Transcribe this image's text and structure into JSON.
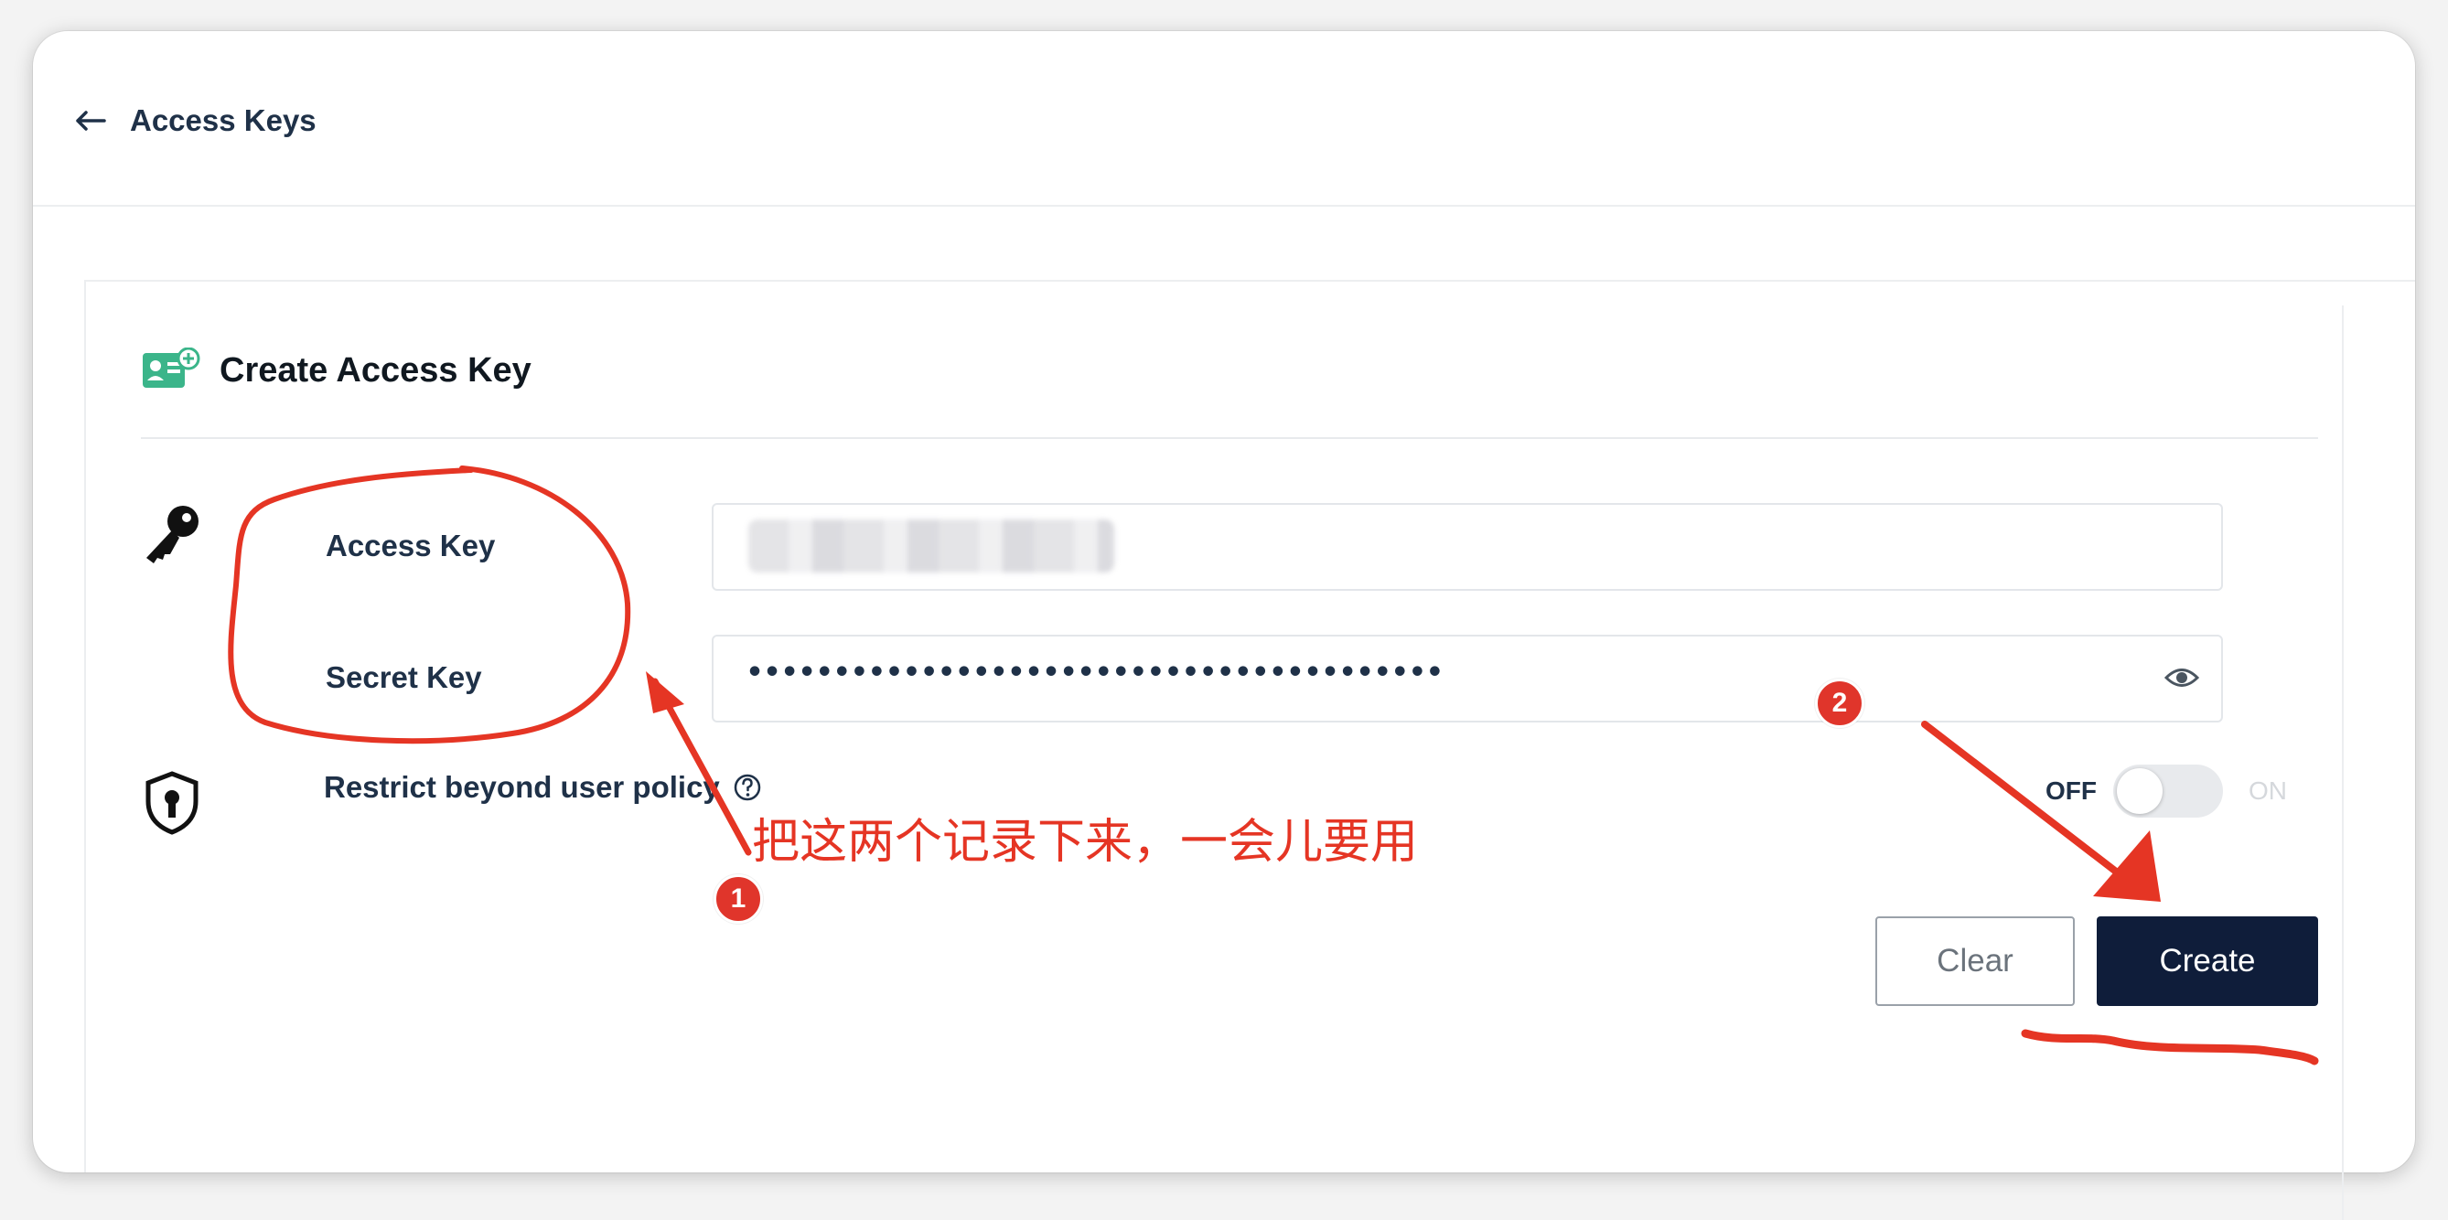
{
  "header": {
    "back_label": "Access Keys"
  },
  "card": {
    "title": "Create Access Key"
  },
  "fields": {
    "access_key_label": "Access Key",
    "secret_key_label": "Secret Key",
    "secret_key_value": "••••••••••••••••••••••••••••••••••••••••"
  },
  "restrict": {
    "label": "Restrict beyond user policy",
    "toggle_off": "OFF",
    "toggle_on": "ON",
    "state": "off"
  },
  "buttons": {
    "clear": "Clear",
    "create": "Create"
  },
  "annotations": {
    "note": "把这两个记录下来，一会儿要用",
    "badge_1": "1",
    "badge_2": "2",
    "color": "#e53524"
  },
  "colors": {
    "primary": "#0f1d3a",
    "text": "#1f3148",
    "icon_green": "#3bb58a"
  },
  "icons": [
    "back-arrow-icon",
    "id-card-add-icon",
    "key-icon",
    "shield-lock-icon",
    "eye-icon",
    "help-circle-icon"
  ]
}
